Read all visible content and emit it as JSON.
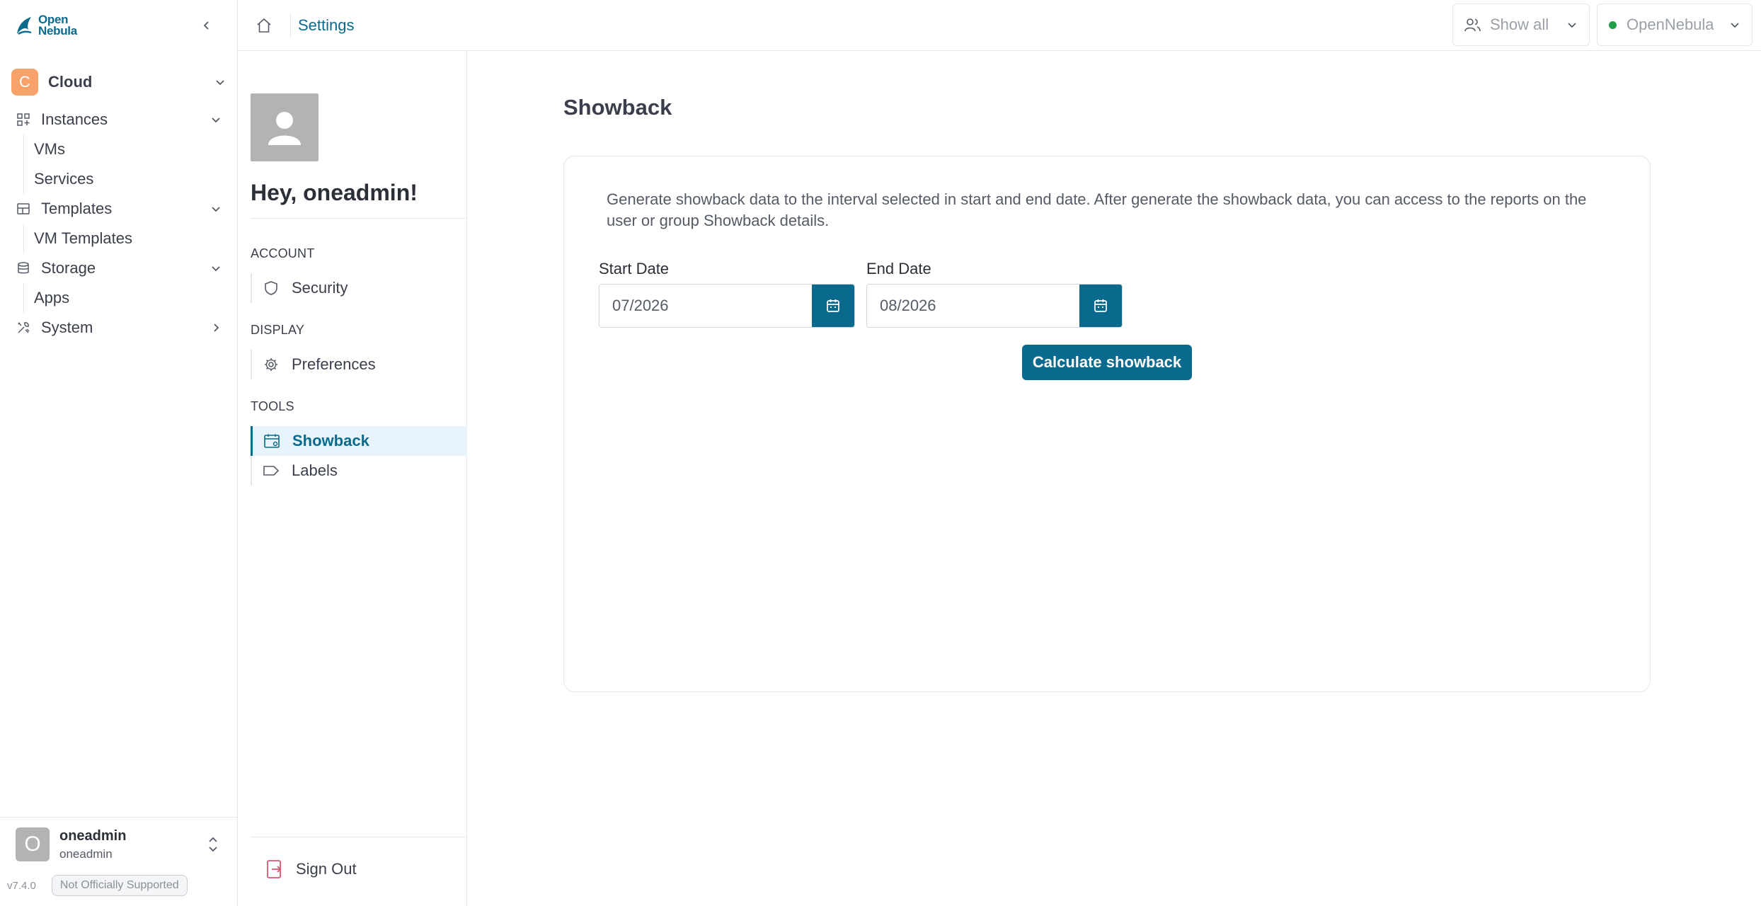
{
  "app": {
    "logo_line1": "Open",
    "logo_line2": "Nebula",
    "accent_color": "#0a6a8e"
  },
  "sidebar": {
    "group": {
      "badge": "C",
      "label": "Cloud",
      "badge_color": "#f7a26a"
    },
    "items": [
      {
        "label": "Instances",
        "icon": "instances-icon",
        "children": [
          "VMs",
          "Services"
        ]
      },
      {
        "label": "Templates",
        "icon": "templates-icon",
        "children": [
          "VM Templates"
        ]
      },
      {
        "label": "Storage",
        "icon": "storage-icon",
        "children": [
          "Apps"
        ]
      },
      {
        "label": "System",
        "icon": "system-icon",
        "children": []
      }
    ],
    "user": {
      "avatar": "O",
      "name": "oneadmin",
      "group": "oneadmin"
    },
    "version": "v7.4.0",
    "support_badge": "Not Officially Supported"
  },
  "topbar": {
    "breadcrumb": "Settings",
    "group_selector": "Show all",
    "zone_selector": "OpenNebula"
  },
  "settings": {
    "greeting": "Hey, oneadmin!",
    "sections": {
      "account": "ACCOUNT",
      "display": "DISPLAY",
      "tools": "TOOLS"
    },
    "items": {
      "security": "Security",
      "preferences": "Preferences",
      "showback": "Showback",
      "labels": "Labels"
    },
    "sign_out": "Sign Out"
  },
  "main": {
    "title": "Showback",
    "description": "Generate showback data to the interval selected in start and end date. After generate the showback data, you can access to the reports on the user or group Showback details.",
    "start_label": "Start Date",
    "start_value": "07/2026",
    "end_label": "End Date",
    "end_value": "08/2026",
    "calculate_button": "Calculate showback"
  }
}
